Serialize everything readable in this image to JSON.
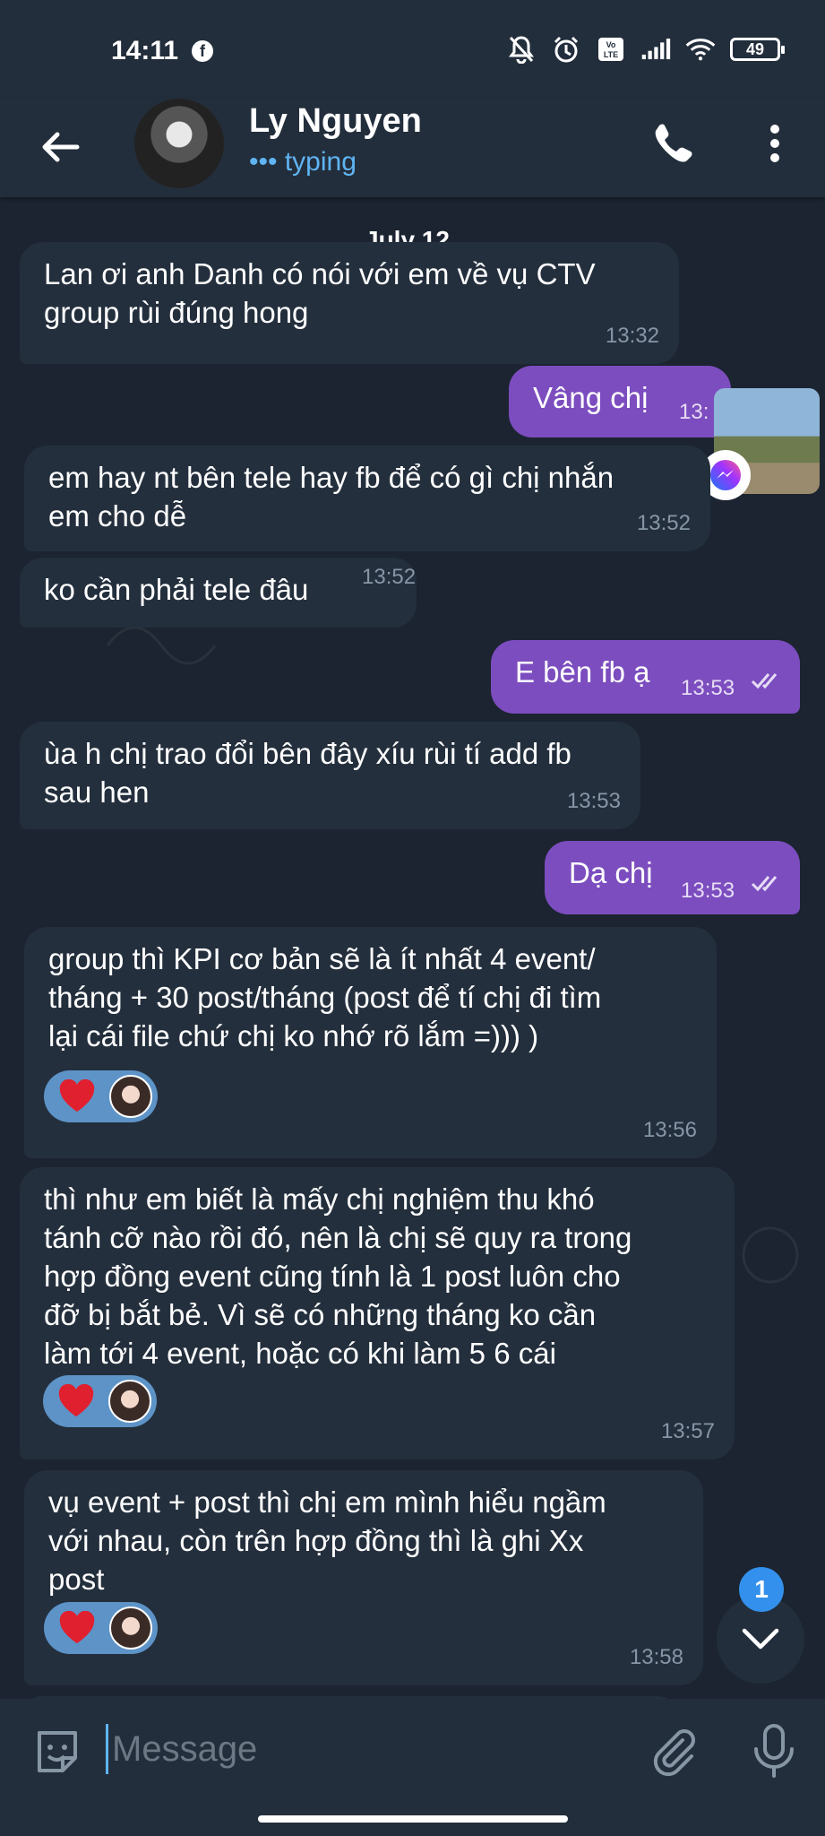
{
  "status_bar": {
    "time": "14:11",
    "fb_icon": "f",
    "battery": "49",
    "volte": "Vo LTE",
    "icons": [
      "bell-off-icon",
      "alarm-icon",
      "volte-icon",
      "signal-icon",
      "wifi-icon",
      "battery-icon"
    ]
  },
  "header": {
    "name": "Ly Nguyen",
    "status": "••• typing"
  },
  "chat": {
    "date": "July 12",
    "messages": [
      {
        "dir": "in",
        "text": "Lan ơi anh Danh có nói với em về vụ CTV\ngroup rùi đúng hong",
        "time": "13:32"
      },
      {
        "dir": "out",
        "text": "Vâng chị",
        "time": "13:"
      },
      {
        "dir": "in",
        "text": "em hay nt bên tele hay fb để có gì chị nhắn\nem cho dễ",
        "time": "13:52"
      },
      {
        "dir": "in",
        "text": "ko cần phải tele đâu",
        "time": "13:52"
      },
      {
        "dir": "out",
        "text": "E bên fb ạ",
        "time": "13:53"
      },
      {
        "dir": "in",
        "text": "ùa h chị trao đổi bên đây xíu rùi tí add fb\nsau hen",
        "time": "13:53"
      },
      {
        "dir": "out",
        "text": "Dạ chị",
        "time": "13:53"
      },
      {
        "dir": "in",
        "text": "group thì KPI cơ bản sẽ là ít nhất 4 event/\ntháng + 30 post/tháng (post để tí chị đi tìm\nlại cái file chứ chị ko nhớ rõ lắm =))) )",
        "time": "13:56"
      },
      {
        "dir": "in",
        "text": "thì như em biết là mấy chị nghiệm thu khó\ntánh cỡ nào rồi đó, nên là chị sẽ quy ra trong\nhợp đồng event cũng tính là 1 post luôn cho\nđỡ bị bắt bẻ. Vì sẽ có những tháng ko cần\nlàm tới 4 event, hoặc có khi làm 5 6 cái",
        "time": "13:57"
      },
      {
        "dir": "in",
        "text": "vụ event + post thì chị em mình hiểu ngầm\nvới nhau, còn trên hợp đồng thì là ghi Xx\npost",
        "time": "13:58"
      }
    ],
    "unread_count": "1"
  },
  "composer": {
    "placeholder": "Message"
  },
  "colors": {
    "background": "#1b2430",
    "bar": "#232e3c",
    "incoming": "#242f3d",
    "outgoing": "#7c4dbf",
    "accent": "#5fb4f2",
    "reaction": "#5d93c7"
  }
}
